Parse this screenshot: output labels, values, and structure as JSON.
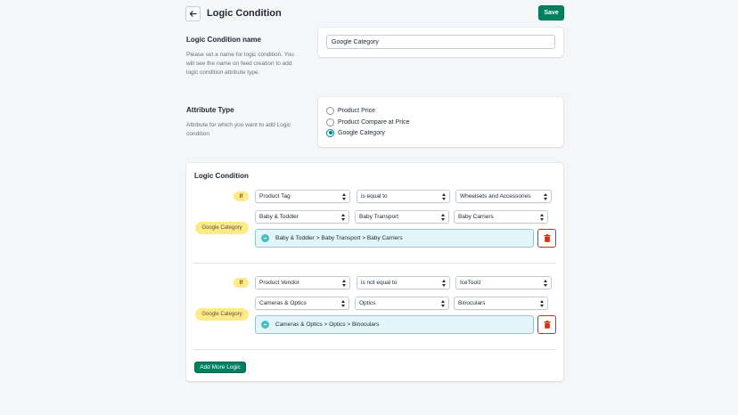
{
  "header": {
    "title": "Logic Condition",
    "save_label": "Save"
  },
  "name_section": {
    "title": "Logic Condition name",
    "description": "Please set a name for logic condition. You will see the name on feed creation to add logic condition attribute type.",
    "input_value": "Google Category"
  },
  "attribute_section": {
    "title": "Attribute Type",
    "description": "Attribute for which you want to add Logic condition",
    "options": [
      {
        "label": "Product Price",
        "checked": false
      },
      {
        "label": "Product Compare at Price",
        "checked": false
      },
      {
        "label": "Google Category",
        "checked": true
      }
    ]
  },
  "logic_section": {
    "title": "Logic Condition",
    "if_label": "If",
    "category_label": "Google Category",
    "add_more_label": "Add More Logic",
    "conditions": [
      {
        "field": "Product Tag",
        "operator": "is equal to",
        "value": "Wheelsets and Accessories",
        "cat1": "Baby & Toddler",
        "cat2": "Baby Transport",
        "cat3": "Baby Carriers",
        "path": "Baby & Toddler > Baby Transport > Baby Carriers"
      },
      {
        "field": "Product Vendor",
        "operator": "is not equal to",
        "value": "IceToolz",
        "cat1": "Cameras & Optics",
        "cat2": "Optics",
        "cat3": "Binoculars",
        "path": "Cameras & Optics > Optics > Binoculars"
      }
    ]
  },
  "colors": {
    "primary": "#008060",
    "badge": "#ffea8a",
    "danger": "#d82c0d",
    "path_bg": "#e4f5fa"
  }
}
